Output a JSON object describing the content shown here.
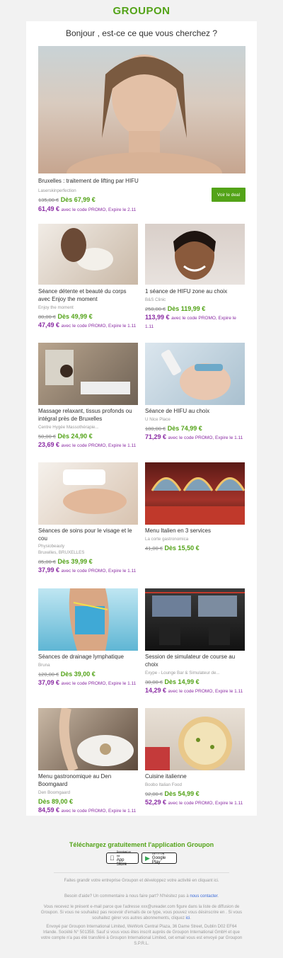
{
  "header": {
    "logo": "GROUPON"
  },
  "greeting": "Bonjour , est-ce ce que vous cherchez ?",
  "hero": {
    "title": "Bruxelles : traitement de lifting par HIFU",
    "merchant": "Laserskinperfection",
    "old_price": "135,00 €",
    "price": "Dès 67,99 €",
    "promo_price": "61,49 €",
    "promo_text": "avec le code PROMO, Expire le 2.11",
    "button": "Voir le deal"
  },
  "deals": [
    {
      "title": "Séance détente et beauté du corps avec Enjoy the moment",
      "merchant": "Enjoy the moment",
      "old_price": "80,00 €",
      "price": "Dès 49,99 €",
      "promo_price": "47,49 €",
      "promo_text": "avec le code PROMO, Expire le 1.11"
    },
    {
      "title": "1 séance de HIFU zone au choix",
      "merchant": "B&S Clinic",
      "old_price": "250,00 €",
      "price": "Dès 119,99 €",
      "promo_price": "113,99 €",
      "promo_text": "avec le code PROMO, Expire le 1.11"
    },
    {
      "title": "Massage relaxant, tissus profonds ou intégral près de Bruxelles",
      "merchant": "Centre Hygée Massothérapie...",
      "old_price": "50,00 €",
      "price": "Dès 24,90 €",
      "promo_price": "23,69 €",
      "promo_text": "avec le code PROMO, Expire le 1.11"
    },
    {
      "title": "Séance de HIFU au choix",
      "merchant": "U Nice Place",
      "old_price": "180,00 €",
      "price": "Dès 74,99 €",
      "promo_price": "71,29 €",
      "promo_text": "avec le code PROMO, Expire le 1.11"
    },
    {
      "title": "Séances de soins pour le visage et le cou",
      "merchant": "Physiobeauty",
      "merchant2": "Bruxelles, BRUXELLES",
      "old_price": "85,00 €",
      "price": "Dès 39,99 €",
      "promo_price": "37,99 €",
      "promo_text": "avec le code PROMO, Expire le 1.11"
    },
    {
      "title": "Menu Italien en 3 services",
      "merchant": "La corte gastronomica",
      "old_price": "41,00 €",
      "price": "Dès 15,50 €"
    },
    {
      "title": "Séances de drainage lymphatique",
      "merchant": "Bruna",
      "old_price": "120,00 €",
      "price": "Dès 39,00 €",
      "promo_price": "37,09 €",
      "promo_text": "avec le code PROMO, Expire le 1.11"
    },
    {
      "title": "Session de simulateur de course au choix",
      "merchant": "Exype - Lounge Bar & Simulateur de...",
      "old_price": "30,00 €",
      "price": "Dès 14,99 €",
      "promo_price": "14,29 €",
      "promo_text": "avec le code PROMO, Expire le 1.11"
    },
    {
      "title": "Menu gastronomique au Den Boomgaard",
      "merchant": "Den Boomgaard",
      "price": "Dès 89,00 €",
      "promo_price": "84,59 €",
      "promo_text": "avec le code PROMO, Expire le 1.11"
    },
    {
      "title": "Cuisine italienne",
      "merchant": "Boobo Italian Food",
      "old_price": "92,00 €",
      "price": "Dès 54,99 €",
      "promo_price": "52,29 €",
      "promo_text": "avec le code PROMO, Expire le 1.11"
    }
  ],
  "footer": {
    "app_title": "Téléchargez gratuitement l'application Groupon",
    "app_store": "App Store",
    "app_store_small": "Download on the",
    "google_play": "Google Play",
    "google_play_small": "GET IT ON",
    "business": "Faites grandir votre entreprise Groupon et développez votre activité en cliquant ici.",
    "help": "Besoin d'aide? Un commentaire à nous faire part? N'hésitez pas à",
    "help_link": "nous contacter",
    "notice": "Vous recevez le présent e-mail parce que l'adresse xxx@ureader.com figure dans la liste de diffusion de Groupon. Si vous ne souhaitez pas recevoir d'emails de ce type, vous pouvez vous désinscrire en . Si vous souhaitez gérer vos autres abonnements, cliquez",
    "notice_link": "ici",
    "legal": "Envoyé par Groupon International Limited, WeWork Central Plaza, 36 Dame Street, Dublin D02 EF64 Irlande. Société N° 501358. Sauf si vous vous êtes inscrit auprès de Groupon International GmbH et que votre compte n'a pas été transféré à Groupon International Limited, cet email vous est envoyé par Groupon S.P.R.L."
  }
}
